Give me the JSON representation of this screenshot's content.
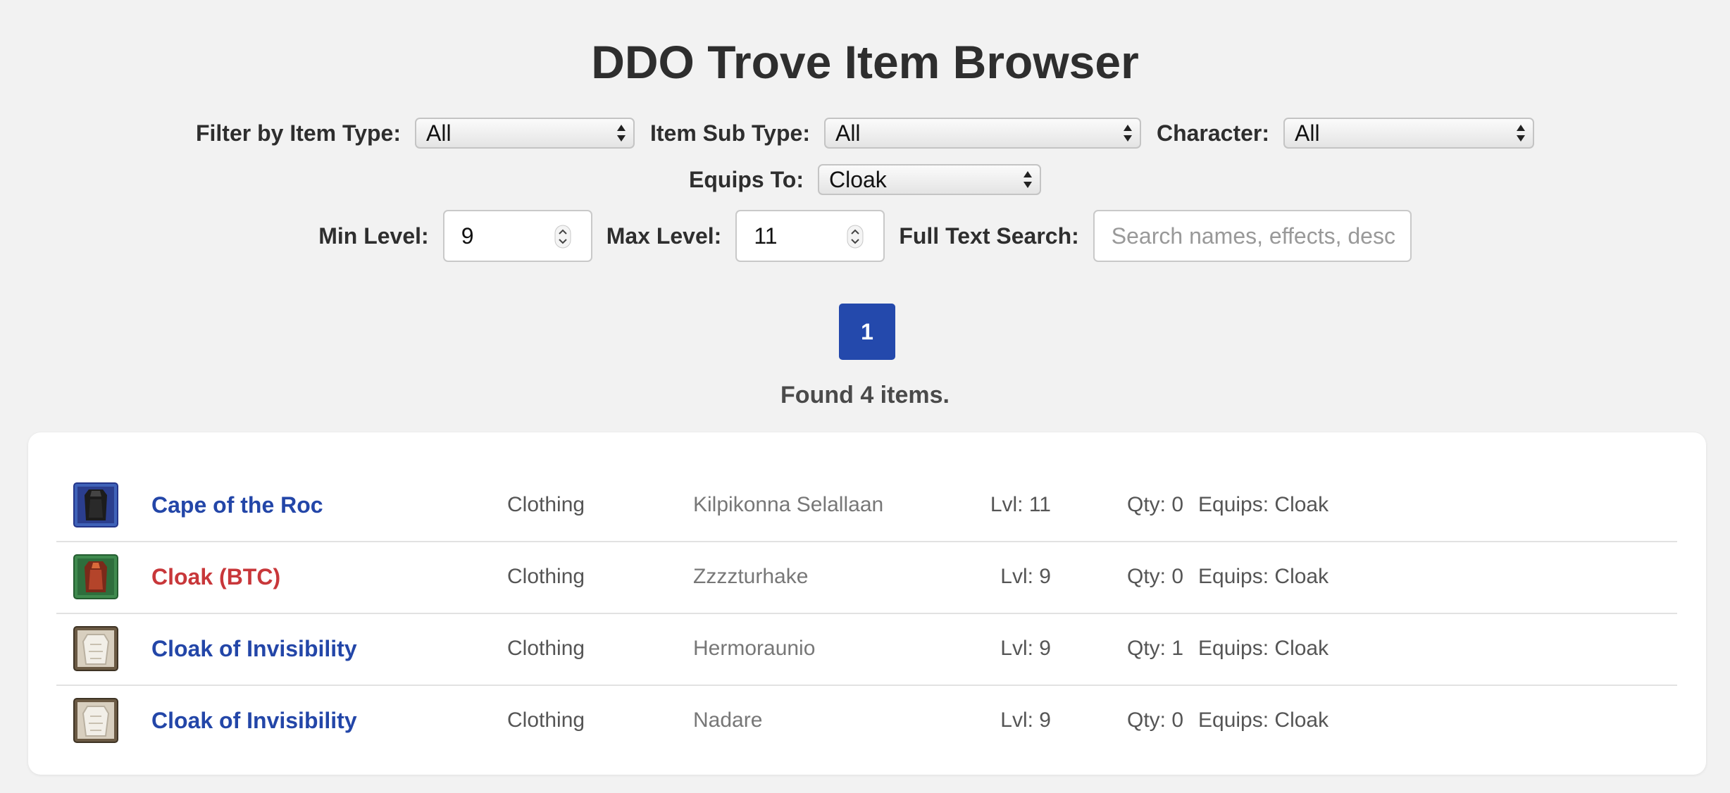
{
  "page_title": "DDO Trove Item Browser",
  "filters": {
    "item_type_label": "Filter by Item Type:",
    "item_type_value": "All",
    "sub_type_label": "Item Sub Type:",
    "sub_type_value": "All",
    "character_label": "Character:",
    "character_value": "All",
    "equips_to_label": "Equips To:",
    "equips_to_value": "Cloak",
    "min_level_label": "Min Level:",
    "min_level_value": "9",
    "max_level_label": "Max Level:",
    "max_level_value": "11",
    "search_label": "Full Text Search:",
    "search_placeholder": "Search names, effects, desc"
  },
  "pagination": {
    "current_page": "1"
  },
  "results": {
    "summary": "Found 4 items.",
    "items": [
      {
        "name": "Cape of the Roc",
        "type": "Clothing",
        "character": "Kilpikonna Selallaan",
        "level": "Lvl: 11",
        "qty": "Qty: 0",
        "equips": "Equips: Cloak",
        "icon": "cloak-roc-icon",
        "name_color": "#2346a8"
      },
      {
        "name": "Cloak (BTC)",
        "type": "Clothing",
        "character": "Zzzzturhake",
        "level": "Lvl: 9",
        "qty": "Qty: 0",
        "equips": "Equips: Cloak",
        "icon": "cloak-btc-icon",
        "name_color": "#c8373a"
      },
      {
        "name": "Cloak of Invisibility",
        "type": "Clothing",
        "character": "Hermoraunio",
        "level": "Lvl: 9",
        "qty": "Qty: 1",
        "equips": "Equips: Cloak",
        "icon": "cloak-invisibility-icon",
        "name_color": "#2346a8"
      },
      {
        "name": "Cloak of Invisibility",
        "type": "Clothing",
        "character": "Nadare",
        "level": "Lvl: 9",
        "qty": "Qty: 0",
        "equips": "Equips: Cloak",
        "icon": "cloak-invisibility-icon",
        "name_color": "#2346a8"
      }
    ]
  }
}
